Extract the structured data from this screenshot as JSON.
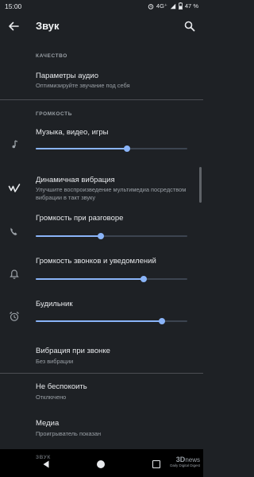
{
  "status": {
    "time": "15:00",
    "network": "4G⁺",
    "battery": "47 %"
  },
  "toolbar": {
    "title": "Звук"
  },
  "sections": {
    "quality_header": "КАЧЕСТВО",
    "volume_header": "ГРОМКОСТЬ",
    "bottom_header_partial": "ЗВУК"
  },
  "audio_params": {
    "title": "Параметры аудио",
    "summary": "Оптимизируйте звучание под себя"
  },
  "media_volume": {
    "title": "Музыка, видео, игры",
    "level": 0.6
  },
  "dynamic_vibration": {
    "title": "Динамичная вибрация",
    "summary": "Улучшите воспроизведение мультимедиа посредством вибрации в такт звуку"
  },
  "call_volume": {
    "title": "Громкость при разговоре",
    "level": 0.43
  },
  "ring_volume": {
    "title": "Громкость звонков и уведомлений",
    "level": 0.71
  },
  "alarm_volume": {
    "title": "Будильник",
    "level": 0.83
  },
  "vibrate_on_ring": {
    "title": "Вибрация при звонке",
    "summary": "Без вибрации"
  },
  "do_not_disturb": {
    "title": "Не беспокоить",
    "summary": "Отключено"
  },
  "media": {
    "title": "Медиа",
    "summary": "Проигрыватель показан"
  },
  "watermark": {
    "logo": "3D",
    "brand": "news",
    "tagline": "Daily Digital Digest"
  },
  "colors": {
    "background": "#1e2125",
    "accent": "#8ab4f8",
    "secondary_text": "#9aa0a6"
  },
  "icons": [
    "back-arrow-icon",
    "search-icon",
    "music-note-icon",
    "vibration-icon",
    "phone-icon",
    "bell-icon",
    "alarm-clock-icon"
  ]
}
